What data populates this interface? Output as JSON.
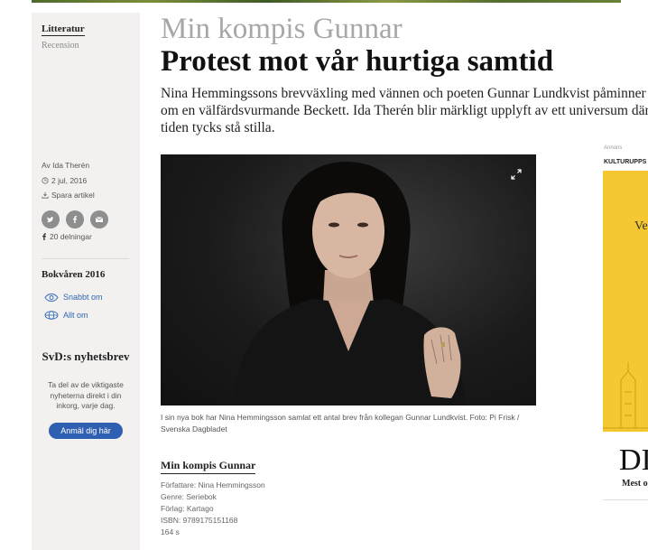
{
  "colors": {
    "link": "#2f67b3",
    "button": "#2f5fb0",
    "sidebar_bg": "#f2f1ef",
    "ad_yellow": "#f5c831"
  },
  "section": {
    "label": "Litteratur",
    "sub": "Recension"
  },
  "meta": {
    "author": "Av Ida Therén",
    "date": "2 jul, 2016",
    "save": "Spara artikel",
    "share_icons": [
      "twitter-icon",
      "facebook-icon",
      "mail-icon"
    ],
    "share_count": "20 delningar"
  },
  "topic": {
    "title": "Bokvåren 2016",
    "links": [
      {
        "label": "Snabbt om",
        "icon": "eye-icon"
      },
      {
        "label": "Allt om",
        "icon": "globe-icon"
      }
    ]
  },
  "newsletter": {
    "title": "SvD:s nyhetsbrev",
    "desc": "Ta del av de viktigaste nyheterna direkt i din inkorg, varje dag.",
    "button": "Anmäl dig här"
  },
  "article": {
    "kicker": "Min kompis Gunnar",
    "headline": "Protest mot vår hurtiga samtid",
    "ingress": "Nina Hemmingssons brevväxling med vännen och poeten Gunnar Lundkvist påminner om en välfärdsvurmande Beckett. Ida Therén blir märkligt upplyft av ett universum där tiden tycks stå stilla.",
    "caption": "I sin nya bok har Nina Hemmingsson samlat ett antal brev från kollegan Gunnar Lundkvist. Foto: Pi Frisk / Svenska Dagbladet"
  },
  "factbox": {
    "title": "Min kompis Gunnar",
    "lines": [
      "Författare: Nina Hemmingsson",
      "Genre: Seriebok",
      "Förlag: Kartago",
      "ISBN: 9789175151168",
      "164 s"
    ]
  },
  "ad": {
    "label": "Annons",
    "brand": "KULTURUPPS",
    "box_text": "Ve",
    "big_text": "DI",
    "small_text": "Mest o"
  }
}
